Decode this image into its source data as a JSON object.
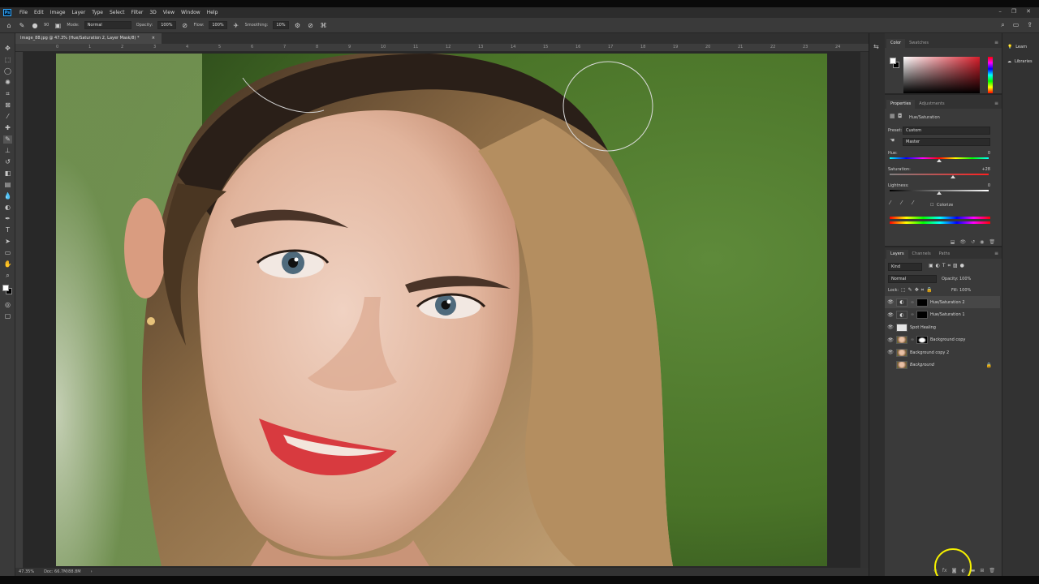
{
  "menu": {
    "logo": "Ps",
    "items": [
      "File",
      "Edit",
      "Image",
      "Layer",
      "Type",
      "Select",
      "Filter",
      "3D",
      "View",
      "Window",
      "Help"
    ]
  },
  "window_controls": {
    "minimize": "–",
    "restore": "❐",
    "close": "✕"
  },
  "options": {
    "mode_label": "Mode:",
    "mode_value": "Normal",
    "opacity_label": "Opacity:",
    "opacity_value": "100%",
    "flow_label": "Flow:",
    "flow_value": "100%",
    "smoothing_label": "Smoothing:",
    "smoothing_value": "10%",
    "brush_size": "90"
  },
  "document": {
    "tab_title": "Image_88.jpg @ 47.3% (Hue/Saturation 2, Layer Mask/8) *",
    "tab_close": "×",
    "ruler_numbers": [
      "0",
      "1",
      "2",
      "3",
      "4",
      "5",
      "6",
      "7",
      "8",
      "9",
      "10",
      "11",
      "12",
      "13",
      "14",
      "15",
      "16",
      "17",
      "18",
      "19",
      "20",
      "21",
      "22",
      "23",
      "24"
    ],
    "status_zoom": "47.35%",
    "status_doc": "Doc: 66.7M/88.8M",
    "status_arrow": "›"
  },
  "color_panel": {
    "tabs": [
      "Color",
      "Swatches"
    ]
  },
  "properties": {
    "tabs": [
      "Properties",
      "Adjustments"
    ],
    "adjustment_title": "Hue/Saturation",
    "preset_label": "Preset:",
    "preset_value": "Custom",
    "channel_value": "Master",
    "hue_label": "Hue:",
    "hue_value": "0",
    "hue_pos": 0.5,
    "saturation_label": "Saturation:",
    "saturation_value": "+28",
    "saturation_pos": 0.64,
    "lightness_label": "Lightness:",
    "lightness_value": "0",
    "lightness_pos": 0.5,
    "colorize_label": "Colorize"
  },
  "layers_panel": {
    "tabs": [
      "Layers",
      "Channels",
      "Paths"
    ],
    "filter_kind": "Kind",
    "blend_mode": "Normal",
    "opacity_label": "Opacity:",
    "opacity_value": "100%",
    "lock_label": "Lock:",
    "fill_label": "Fill:",
    "fill_value": "100%",
    "layers": [
      {
        "name": "Hue/Saturation 2",
        "thumb": "adj",
        "mask": "mask-black",
        "selected": true,
        "visible": true
      },
      {
        "name": "Hue/Saturation 1",
        "thumb": "adj",
        "mask": "mask-black",
        "selected": false,
        "visible": true
      },
      {
        "name": "Spot Healing",
        "thumb": "white",
        "mask": "",
        "selected": false,
        "visible": true
      },
      {
        "name": "Background copy",
        "thumb": "face",
        "mask": "mask-face",
        "selected": false,
        "visible": true
      },
      {
        "name": "Background copy 2",
        "thumb": "face",
        "mask": "",
        "selected": false,
        "visible": true
      },
      {
        "name": "Background",
        "thumb": "face",
        "mask": "",
        "selected": false,
        "visible": false,
        "italic": true,
        "locked": true
      }
    ]
  },
  "learn_panel": {
    "items": [
      "Learn",
      "Libraries"
    ]
  }
}
